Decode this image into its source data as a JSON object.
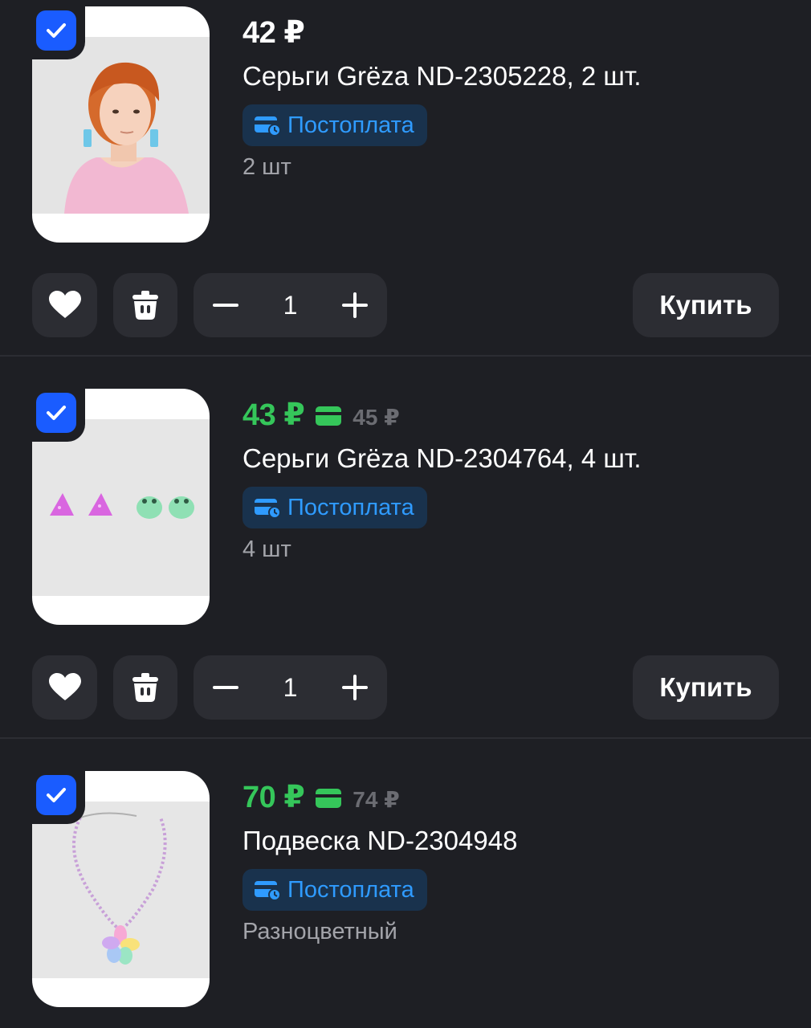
{
  "items": [
    {
      "price": "42 ₽",
      "old_price": "",
      "title": "Серьги Grëza ND-2305228, 2 шт.",
      "badge": "Постоплата",
      "subtext": "2 шт",
      "quantity": "1",
      "buy_label": "Купить",
      "checked": true
    },
    {
      "price": "43 ₽",
      "old_price": "45 ₽",
      "title": "Серьги Grëza ND-2304764, 4 шт.",
      "badge": "Постоплата",
      "subtext": "4 шт",
      "quantity": "1",
      "buy_label": "Купить",
      "checked": true
    },
    {
      "price": "70 ₽",
      "old_price": "74 ₽",
      "title": "Подвеска ND-2304948",
      "badge": "Постоплата",
      "subtext": "Разноцветный",
      "checked": true
    }
  ],
  "colors": {
    "background": "#1e1f24",
    "accent_blue": "#1a5cff",
    "price_green": "#35c65a",
    "badge_text": "#2f9bff",
    "badge_bg": "#19324d",
    "button_bg": "#2c2d33"
  },
  "icons": [
    "check-icon",
    "heart-icon",
    "trash-icon",
    "minus-icon",
    "plus-icon",
    "wallet-card-icon",
    "card-icon"
  ]
}
